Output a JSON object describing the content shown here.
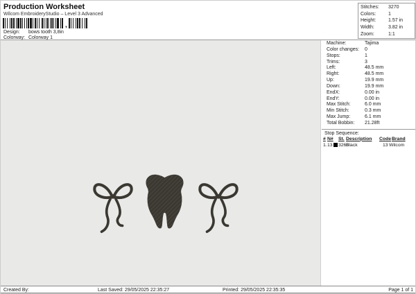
{
  "header": {
    "title": "Production Worksheet",
    "subtitle": "Wilcom EmbroideryStudio – Level 3 Advanced",
    "design_label": "Design:",
    "design_value": "bows tooth 3,8in",
    "colorway_label": "Colorway:",
    "colorway_value": "Colorway 1",
    "barcode": {
      "icon": "barcode-icon",
      "groups": [
        "2112131121221131211212112131122112132112112211211211321121",
        "21121311212213112"
      ],
      "separator": ","
    }
  },
  "summary": {
    "rows": [
      {
        "label": "Stitches:",
        "value": "3270"
      },
      {
        "label": "Colors:",
        "value": "1"
      },
      {
        "label": "Height:",
        "value": "1.57 in"
      },
      {
        "label": "Width:",
        "value": "3.82 in"
      },
      {
        "label": "Zoom:",
        "value": "1:1"
      }
    ]
  },
  "machine_info": {
    "rows": [
      {
        "label": "Machine:",
        "value": "Tajima"
      },
      {
        "label": "Color changes:",
        "value": "0"
      },
      {
        "label": "Stops:",
        "value": "1"
      },
      {
        "label": "Trims:",
        "value": "3"
      },
      {
        "label": "Left:",
        "value": "48.5 mm"
      },
      {
        "label": "Right:",
        "value": "48.5 mm"
      },
      {
        "label": "Up:",
        "value": "19.9 mm"
      },
      {
        "label": "Down:",
        "value": "19.9 mm"
      },
      {
        "label": "EndX:",
        "value": "0.00 in"
      },
      {
        "label": "EndY:",
        "value": "0.00 in"
      },
      {
        "label": "Max Stitch:",
        "value": "6.0 mm"
      },
      {
        "label": "Min Stitch:",
        "value": "0.3 mm"
      },
      {
        "label": "Max Jump:",
        "value": "6.1 mm"
      },
      {
        "label": "Total Bobbin:",
        "value": "21.28ft"
      }
    ]
  },
  "stop_sequence": {
    "title": "Stop Sequence:",
    "columns": [
      "#",
      "N#",
      "St.",
      "Description",
      "Code",
      "Brand"
    ],
    "rows": [
      {
        "num": "1.",
        "n": "13",
        "swatch": "#000000",
        "st": "3268",
        "description": "Black",
        "code": "13",
        "brand": "Wilcom"
      }
    ]
  },
  "canvas": {
    "background": "#e9e9e8",
    "thread_color": "#3a3831",
    "design_elements": [
      "left-bow",
      "tooth",
      "right-bow"
    ]
  },
  "footer": {
    "created_by_label": "Created By:",
    "last_saved": "Last Saved: 29/05/2025 22:35:27",
    "printed": "Printed: 29/05/2025 22:35:35",
    "page": "Page 1 of 1"
  }
}
